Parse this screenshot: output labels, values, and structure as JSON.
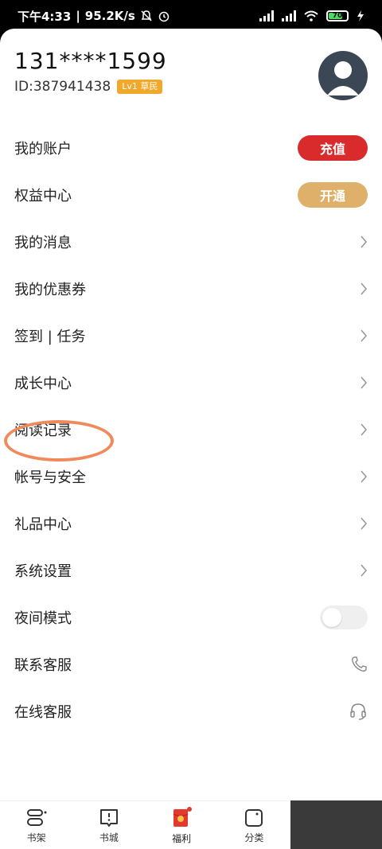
{
  "status": {
    "time": "下午4:33",
    "speed": "95.2K/s",
    "battery": "70"
  },
  "profile": {
    "phone": "131****1599",
    "id": "ID:387941438",
    "level": "Lv1 草民"
  },
  "menu": [
    {
      "label": "我的账户",
      "action": "充值"
    },
    {
      "label": "权益中心",
      "action": "开通"
    },
    {
      "label": "我的消息"
    },
    {
      "label": "我的优惠券"
    },
    {
      "label": "签到 | 任务"
    },
    {
      "label": "成长中心"
    },
    {
      "label": "阅读记录"
    },
    {
      "label": "帐号与安全"
    },
    {
      "label": "礼品中心"
    },
    {
      "label": "系统设置"
    },
    {
      "label": "夜间模式"
    },
    {
      "label": "联系客服"
    },
    {
      "label": "在线客服"
    }
  ],
  "tabs": [
    {
      "label": "书架"
    },
    {
      "label": "书城"
    },
    {
      "label": "福利"
    },
    {
      "label": "分类"
    }
  ],
  "colors": {
    "recharge": "#d92b2b",
    "open": "#dfb06a",
    "level": "#f0a92b",
    "highlight": "#f08a5d"
  }
}
